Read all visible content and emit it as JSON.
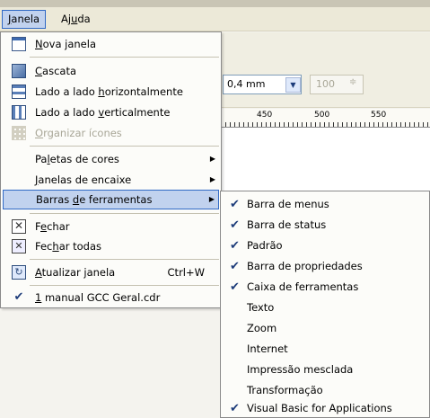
{
  "menubar": {
    "janela": {
      "pre": "",
      "u": "J",
      "post": "anela"
    },
    "ajuda": {
      "pre": "Aj",
      "u": "u",
      "post": "da"
    }
  },
  "toolbar": {
    "outline_width": "0,4 mm",
    "zoom": "100"
  },
  "ruler": {
    "labels": [
      "450",
      "500",
      "550"
    ]
  },
  "janela_menu": {
    "items": [
      {
        "pre": "",
        "u": "N",
        "post": "ova janela",
        "icon": "new-window-icon"
      },
      {
        "pre": "",
        "u": "C",
        "post": "ascata",
        "icon": "cascade-icon"
      },
      {
        "pre": "Lado a lado ",
        "u": "h",
        "post": "orizontalmente",
        "icon": "tile-horizontal-icon"
      },
      {
        "pre": "Lado a lado ",
        "u": "v",
        "post": "erticalmente",
        "icon": "tile-vertical-icon"
      },
      {
        "pre": "",
        "u": "O",
        "post": "rganizar ícones",
        "icon": "arrange-icons-icon",
        "disabled": true
      },
      {
        "pre": "Pa",
        "u": "l",
        "post": "etas de cores"
      },
      {
        "pre": "",
        "u": "J",
        "post": "anelas de encaixe"
      },
      {
        "pre": "Barras ",
        "u": "d",
        "post": "e ferramentas"
      },
      {
        "pre": "F",
        "u": "e",
        "post": "char",
        "icon": "close-window-icon"
      },
      {
        "pre": "Fec",
        "u": "h",
        "post": "ar todas",
        "icon": "close-all-icon"
      },
      {
        "pre": "",
        "u": "A",
        "post": "tualizar janela",
        "icon": "refresh-window-icon",
        "shortcut": "Ctrl+W"
      },
      {
        "pre": "",
        "u": "1",
        "post": " manual GCC Geral.cdr",
        "icon": "check-icon"
      }
    ]
  },
  "toolbars_submenu": {
    "items": [
      {
        "label": "Barra de menus",
        "checked": true
      },
      {
        "label": "Barra de status",
        "checked": true
      },
      {
        "label": "Padrão",
        "checked": true
      },
      {
        "label": "Barra de propriedades",
        "checked": true
      },
      {
        "label": "Caixa de ferramentas",
        "checked": true
      },
      {
        "label": "Texto",
        "checked": false
      },
      {
        "label": "Zoom",
        "checked": false
      },
      {
        "label": "Internet",
        "checked": false
      },
      {
        "label": "Impressão mesclada",
        "checked": false
      },
      {
        "label": "Transformação",
        "checked": false
      },
      {
        "label": "Visual Basic for Applications",
        "checked": true
      }
    ]
  },
  "glyphs": {
    "check": "✔",
    "arrow": "▶",
    "close": "✕",
    "refresh": "↻",
    "dropdown": "▼",
    "spin": "≑"
  }
}
